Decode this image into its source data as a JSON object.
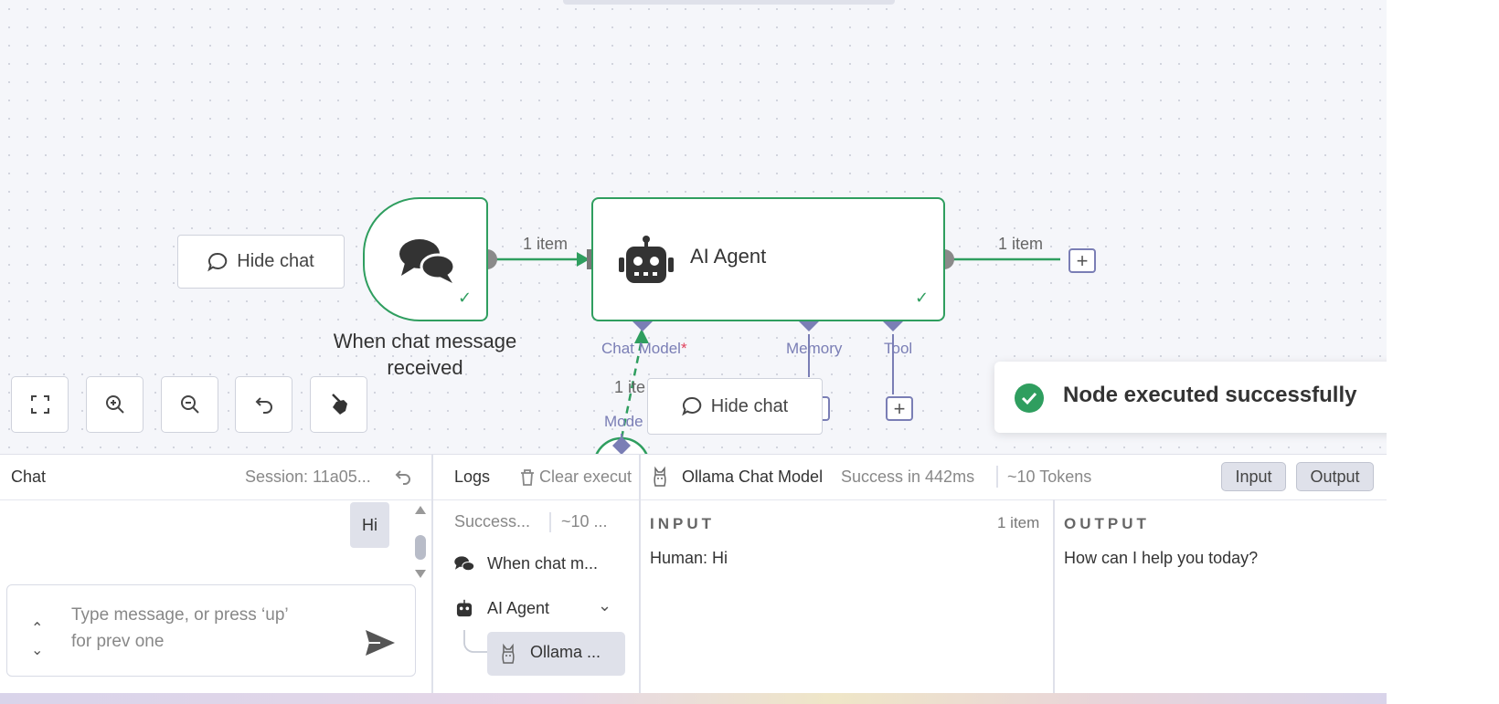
{
  "canvas": {
    "trigger_node": {
      "label": "When chat message received"
    },
    "agent_node": {
      "label": "AI Agent"
    },
    "edge_labels": {
      "trigger_to_agent": "1 item",
      "agent_output": "1 item",
      "model_edge": "1 ite"
    },
    "ports": {
      "chat_model": "Chat Model",
      "chat_model_required": "*",
      "memory": "Memory",
      "tool": "Tool",
      "model_partial": "Mode"
    },
    "hide_chat_primary": "Hide chat",
    "hide_chat_secondary": "Hide chat",
    "toast": {
      "message": "Node executed successfully"
    }
  },
  "chat": {
    "title": "Chat",
    "session": "Session: 11a05...",
    "user_message": "Hi",
    "input_placeholder_line1": "Type message, or press ‘up’",
    "input_placeholder_line2": "for prev one"
  },
  "logs": {
    "title": "Logs",
    "clear_label": "Clear execut",
    "summary_status": "Success...",
    "summary_tokens": "~10 ...",
    "tree": [
      {
        "label": "When chat m...",
        "icon": "chat-bubbles-icon"
      },
      {
        "label": "AI Agent",
        "icon": "robot-icon"
      },
      {
        "label": "Ollama ...",
        "icon": "llama-icon",
        "selected": true
      }
    ]
  },
  "detail": {
    "node_name": "Ollama Chat Model",
    "status": "Success in 442ms",
    "tokens": "~10 Tokens",
    "input_toggle": "Input",
    "output_toggle": "Output",
    "input": {
      "title": "INPUT",
      "count": "1 item",
      "content": "Human: Hi"
    },
    "output": {
      "title": "OUTPUT",
      "content": "How can I help you today?"
    }
  },
  "colors": {
    "success_green": "#2f9e5f",
    "port_purple": "#7a7eb5",
    "required_red": "#e0415c"
  }
}
